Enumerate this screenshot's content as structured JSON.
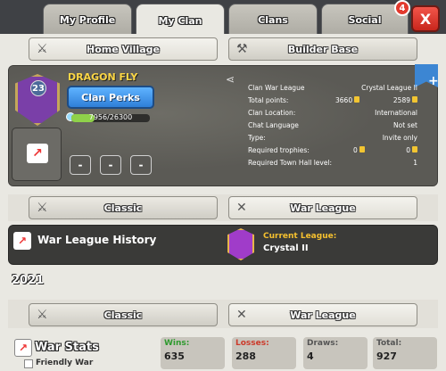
{
  "tabs": [
    {
      "label": "My Profile"
    },
    {
      "label": "My Clan"
    },
    {
      "label": "Clans"
    },
    {
      "label": "Social"
    }
  ],
  "social_badge": "4",
  "close_label": "X",
  "village_tabs": {
    "home": "Home Village",
    "builder": "Builder Base"
  },
  "clan": {
    "name": "DRAGON FLY",
    "level": "23",
    "perks_label": "Clan Perks",
    "xp_text": "7956/26300",
    "xp_fraction": 0.3,
    "dashes": [
      "-",
      "-",
      "-"
    ]
  },
  "clan_stats": [
    {
      "label": "Clan War League",
      "value": "Crystal League II"
    },
    {
      "label": "Total points:",
      "value1": "3660",
      "value2": "2589"
    },
    {
      "label": "Clan Location:",
      "value": "International"
    },
    {
      "label": "Chat Language",
      "value": "Not set"
    },
    {
      "label": "Type:",
      "value": "Invite only"
    },
    {
      "label": "Required trophies:",
      "value1": "0",
      "value2": "0"
    },
    {
      "label": "Required Town Hall level:",
      "value": "1"
    }
  ],
  "mode_tabs": {
    "classic": "Classic",
    "war_league": "War League"
  },
  "war_league_history": {
    "title": "War League History",
    "current_label": "Current League:",
    "current_value": "Crystal II"
  },
  "year": "2021",
  "war_stats": {
    "title": "War Stats",
    "friendly_label": "Friendly War",
    "wins_label": "Wins:",
    "wins": "635",
    "losses_label": "Losses:",
    "losses": "288",
    "draws_label": "Draws:",
    "draws": "4",
    "total_label": "Total:",
    "total": "927"
  },
  "colors": {
    "wins": "#2e9a2e",
    "losses": "#cc3a2a",
    "draws": "#555555",
    "total": "#555555"
  }
}
